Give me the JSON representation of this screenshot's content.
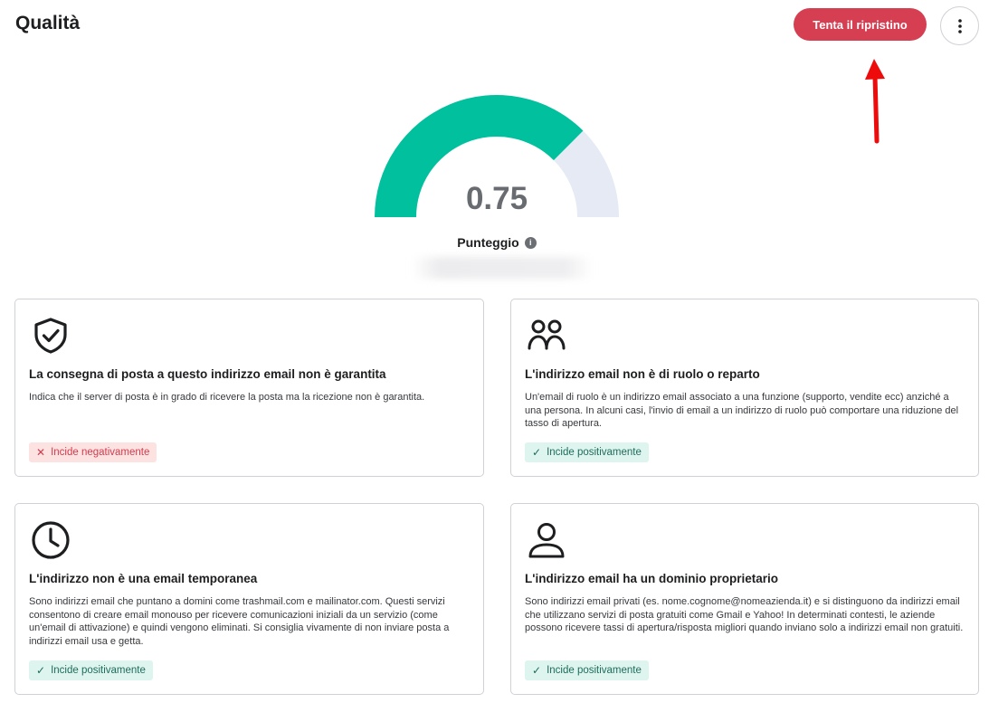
{
  "header": {
    "title": "Qualità",
    "retry_label": "Tenta il ripristino"
  },
  "score": {
    "value": "0.75",
    "fraction": 0.75,
    "label": "Punteggio",
    "info_glyph": "i",
    "colors": {
      "filled": "#00c09e",
      "track": "#e6eaf5"
    }
  },
  "cards": [
    {
      "icon": "shield-check-icon",
      "title": "La consegna di posta a questo indirizzo email non è garantita",
      "text": "Indica che il server di posta è in grado di ricevere la posta ma la ricezione non è garantita.",
      "badge": {
        "type": "negative",
        "glyph": "✕",
        "label": "Incide negativamente"
      }
    },
    {
      "icon": "users-icon",
      "title": "L'indirizzo email non è di ruolo o reparto",
      "text": "Un'email di ruolo è un indirizzo email associato a una funzione (supporto, vendite ecc) anziché a una persona. In alcuni casi, l'invio di email a un indirizzo di ruolo può comportare una riduzione del tasso di apertura.",
      "badge": {
        "type": "positive",
        "glyph": "✓",
        "label": "Incide positivamente"
      }
    },
    {
      "icon": "clock-icon",
      "title": "L'indirizzo non è una email temporanea",
      "text": "Sono indirizzi email che puntano a domini come trashmail.com e mailinator.com. Questi servizi consentono di creare email monouso per ricevere comunicazioni iniziali da un servizio (come un'email di attivazione) e quindi vengono eliminati. Si consiglia vivamente di non inviare posta a indirizzi email usa e getta.",
      "badge": {
        "type": "positive",
        "glyph": "✓",
        "label": "Incide positivamente"
      }
    },
    {
      "icon": "user-icon",
      "title": "L'indirizzo email ha un dominio proprietario",
      "text": "Sono indirizzi email privati (es. nome.cognome@nomeazienda.it) e si distinguono da indirizzi email che utilizzano servizi di posta gratuiti come Gmail e Yahoo! In determinati contesti, le aziende possono ricevere tassi di apertura/risposta migliori quando inviano solo a indirizzi email non gratuiti.",
      "badge": {
        "type": "positive",
        "glyph": "✓",
        "label": "Incide positivamente"
      }
    }
  ]
}
